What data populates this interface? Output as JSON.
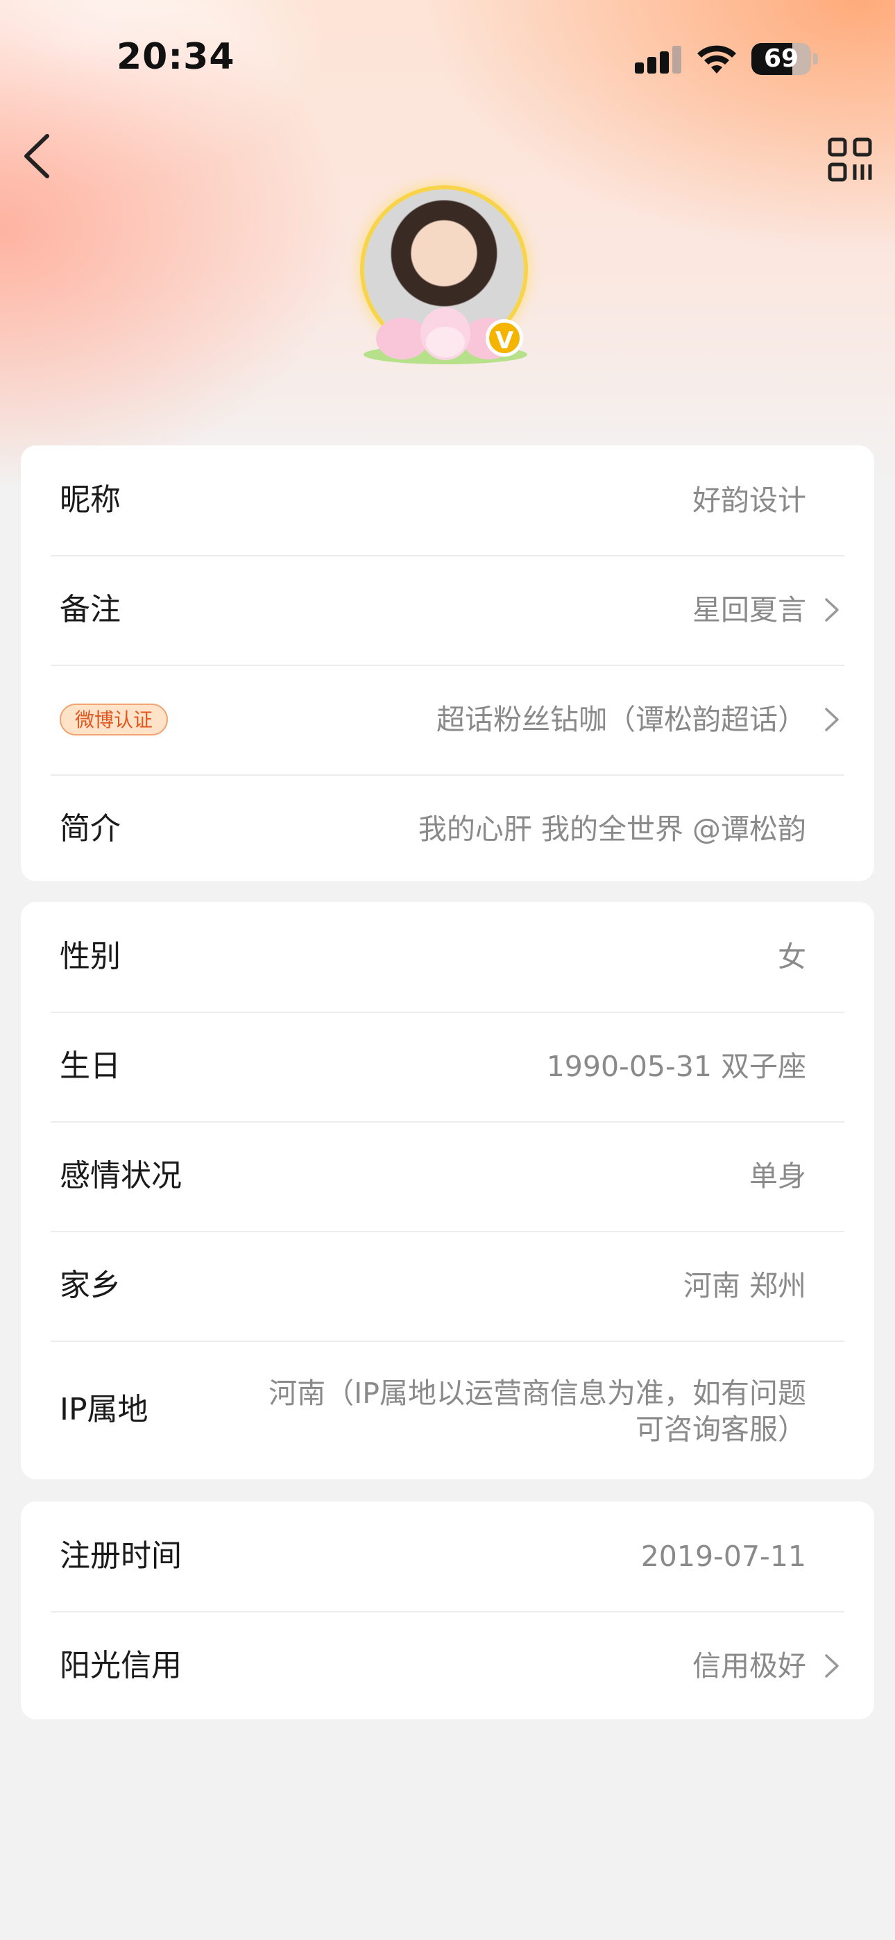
{
  "status_bar": {
    "time": "20:34",
    "battery": "69",
    "battery_level": 0.69
  },
  "header": {
    "back_icon": "chevron-left-icon",
    "qr_icon": "qr-code-icon"
  },
  "profile": {
    "verified_badge": "V"
  },
  "section1": [
    {
      "label": "昵称",
      "value": "好韵设计",
      "chevron": false
    },
    {
      "label": "备注",
      "value": "星回夏言",
      "chevron": true
    },
    {
      "tag": "微博认证",
      "value": "超话粉丝钻咖（谭松韵超话）",
      "chevron": true
    },
    {
      "label": "简介",
      "value": "我的心肝 我的全世界 @谭松韵",
      "chevron": false
    }
  ],
  "section2": [
    {
      "label": "性别",
      "value": "女"
    },
    {
      "label": "生日",
      "value": "1990-05-31 双子座"
    },
    {
      "label": "感情状况",
      "value": "单身"
    },
    {
      "label": "家乡",
      "value": "河南 郑州"
    },
    {
      "label": "IP属地",
      "value_line1": "河南（IP属地以运营商信息为准，如有问题",
      "value_line2": "可咨询客服）"
    }
  ],
  "section3": [
    {
      "label": "注册时间",
      "value": "2019-07-11",
      "chevron": false
    },
    {
      "label": "阳光信用",
      "value": "信用极好",
      "chevron": true
    }
  ],
  "colors": {
    "tag_text": "#e2561f",
    "tag_bg": "#ffe3c9",
    "page_bg": "#f2f2f2",
    "value_text": "#8a8a8a"
  }
}
